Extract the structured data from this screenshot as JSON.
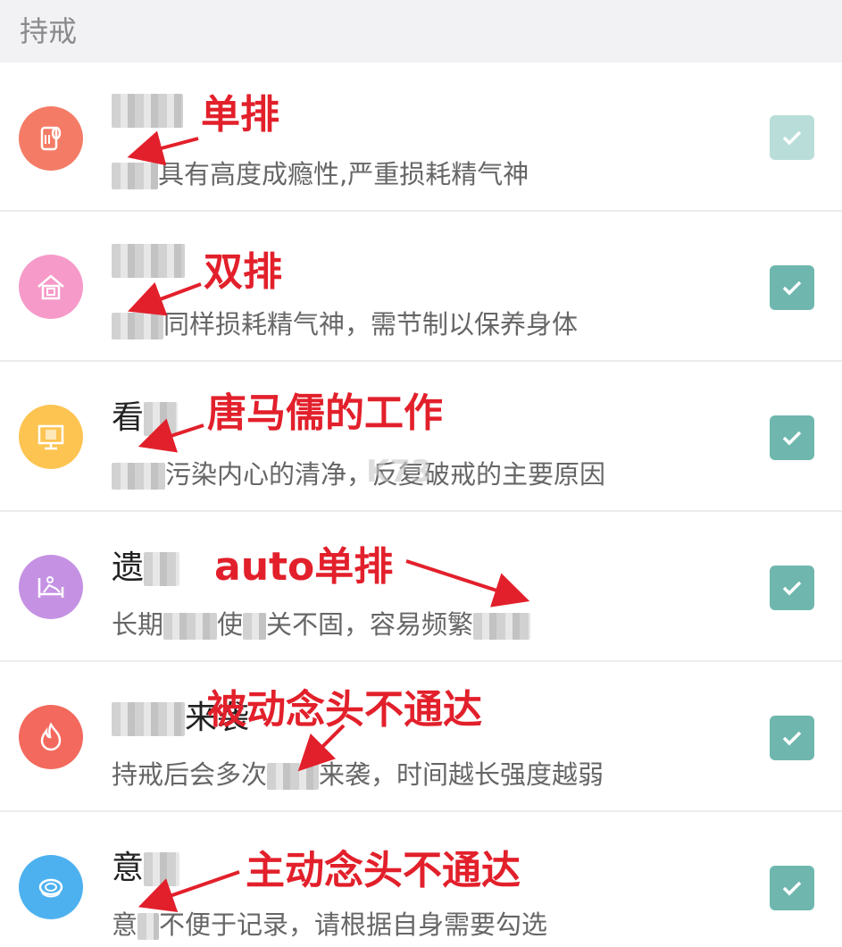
{
  "header": {
    "title": "持戒"
  },
  "rows": [
    {
      "title": "",
      "desc": "具有高度成瘾性,严重损耗精气神",
      "annotation": "单排",
      "icon": "toilet-paper-icon",
      "color": "#f47c66",
      "check_color": "#b9ddd8"
    },
    {
      "title": "",
      "desc": "同样损耗精气神，需节制以保养身体",
      "annotation": "双排",
      "icon": "house-icon",
      "color": "#f59ac9",
      "check_color": "#6fb7ae"
    },
    {
      "title": "看",
      "desc": "污染内心的清净，反复破戒的主要原因",
      "annotation": "唐马儒的工作",
      "icon": "monitor-icon",
      "color": "#fdc452",
      "check_color": "#6fb7ae"
    },
    {
      "title": "遗",
      "desc_a": "长期",
      "desc_b": "使",
      "desc_c": "关不固，容易频繁",
      "annotation": "auto单排",
      "icon": "bed-icon",
      "color": "#c592e3",
      "check_color": "#6fb7ae"
    },
    {
      "title": "来袭",
      "desc_a": "持戒后会多次",
      "desc_b": "来袭，时间越长强度越弱",
      "annotation": "被动念头不通达",
      "icon": "flame-icon",
      "color": "#f3695d",
      "check_color": "#6fb7ae"
    },
    {
      "title": "意",
      "desc_a": "意",
      "desc_b": "不便于记录，请根据自身需要勾选",
      "annotation": "主动念头不通达",
      "icon": "tangle-icon",
      "color": "#4db1ef",
      "check_color": "#6fb7ae"
    }
  ],
  "watermark": "K73"
}
